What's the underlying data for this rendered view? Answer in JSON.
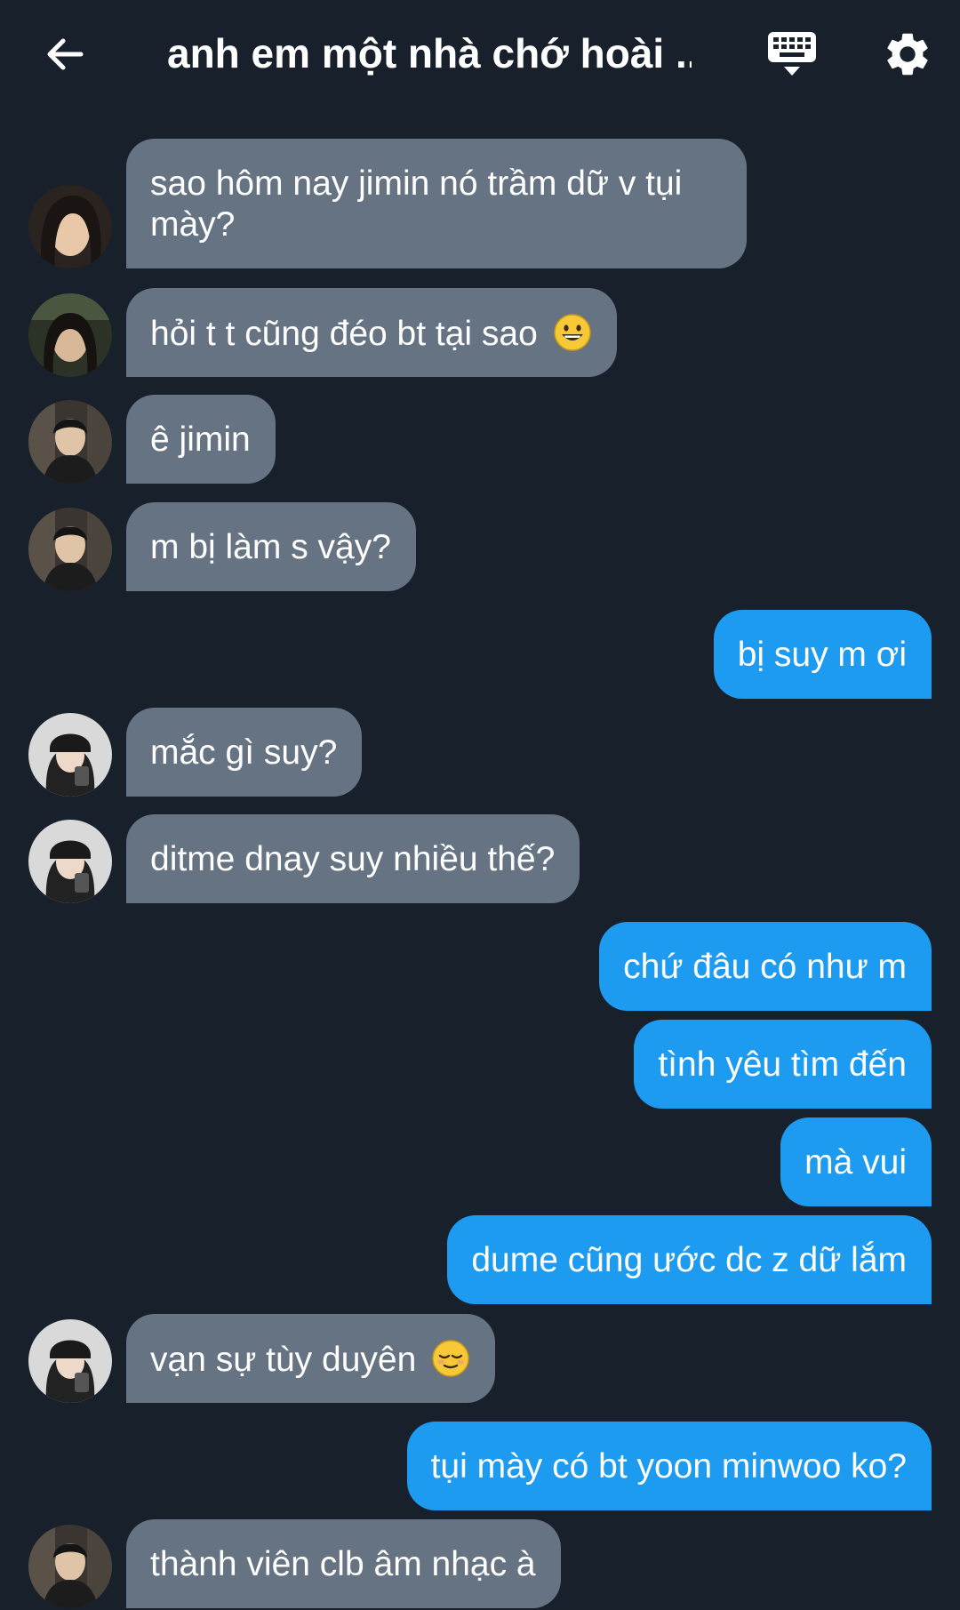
{
  "header": {
    "title": "anh em một nhà chớ hoài ...",
    "back_icon": "arrow-left-icon",
    "keyboard_icon": "keyboard-icon",
    "settings_icon": "gear-icon"
  },
  "colors": {
    "background": "#17202b",
    "incoming_bubble": "#667383",
    "outgoing_bubble": "#1d9bf0"
  },
  "messages": [
    {
      "dir": "in",
      "text": "sao hôm nay jimin nó trầm dữ v tụi mày?",
      "avatar": "avatar-girl-1"
    },
    {
      "dir": "in",
      "text": "hỏi t t cũng đéo bt tại sao",
      "emoji": "grinning-face",
      "avatar": "avatar-girl-2"
    },
    {
      "dir": "in",
      "text": "ê jimin",
      "avatar": "avatar-boy"
    },
    {
      "dir": "in",
      "text": "m bị làm s vậy?",
      "avatar": "avatar-boy"
    },
    {
      "dir": "out",
      "text": "bị suy m ơi"
    },
    {
      "dir": "in",
      "text": "mắc gì suy?",
      "avatar": "avatar-girl-cap"
    },
    {
      "dir": "in",
      "text": "ditme dnay suy nhiều thế?",
      "avatar": "avatar-girl-cap"
    },
    {
      "dir": "out",
      "text": "chứ đâu có như m"
    },
    {
      "dir": "out",
      "text": "tình yêu tìm đến"
    },
    {
      "dir": "out",
      "text": "mà vui"
    },
    {
      "dir": "out",
      "text": "dume cũng ước dc z dữ lắm"
    },
    {
      "dir": "in",
      "text": "vạn sự tùy duyên",
      "emoji": "relieved-face",
      "avatar": "avatar-girl-cap"
    },
    {
      "dir": "out",
      "text": "tụi mày có bt yoon minwoo ko?"
    },
    {
      "dir": "in",
      "text": "thành viên clb âm nhạc à",
      "avatar": "avatar-boy"
    }
  ]
}
